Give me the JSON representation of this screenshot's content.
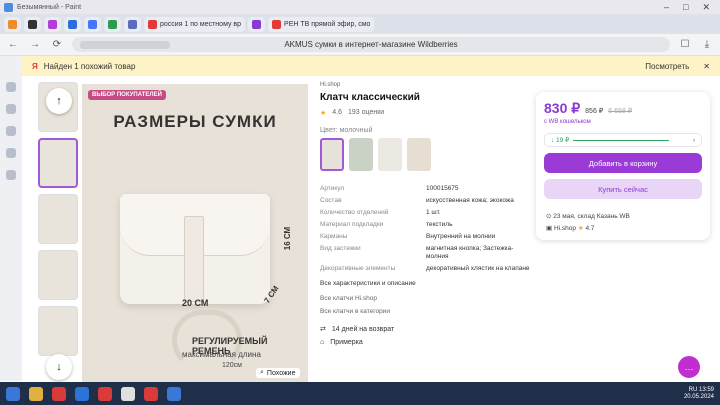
{
  "paint": {
    "title": "Безымянный - Paint"
  },
  "tabs": [
    {
      "label": "",
      "color": "#f08c2b"
    },
    {
      "label": "",
      "color": "#333333"
    },
    {
      "label": "",
      "color": "#b23dd8"
    },
    {
      "label": "",
      "color": "#2a6fdb"
    },
    {
      "label": "",
      "color": "#4477ff"
    },
    {
      "label": "",
      "color": "#2b9b4f"
    },
    {
      "label": "",
      "color": "#5c6bc0"
    },
    {
      "label": "россия 1 по местному вр",
      "color": "#e53935"
    },
    {
      "label": "",
      "color": "#8a3ad4"
    },
    {
      "label": "РЕН ТВ прямой эфир, смо",
      "color": "#e53935"
    }
  ],
  "address": {
    "page_title": "AKMUS сумки в интернет-магазине Wildberries"
  },
  "findbar": {
    "text": "Найден 1 похожий товар",
    "view": "Посмотреть"
  },
  "hero": {
    "badge": "ВЫБОР ПОКУПАТЕЛЕЙ",
    "title": "РАЗМЕРЫ СУМКИ",
    "width": "20 СМ",
    "depth": "7 СМ",
    "height": "16 СМ",
    "strap_title": "РЕГУЛИРУЕМЫЙ РЕМЕНЬ",
    "strap_sub": "максимальная длина",
    "strap_len": "120см",
    "zoom": "Похожие"
  },
  "product": {
    "shop": "Hi.shop",
    "title": "Клатч классический",
    "rating": "4.6",
    "reviews": "193 оценки",
    "color_label": "Цвет: молочный",
    "specs": [
      {
        "k": "Артикул",
        "v": "100015675"
      },
      {
        "k": "Состав",
        "v": "искусственная кожа; экокожа"
      },
      {
        "k": "Количество отделений",
        "v": "1 шт."
      },
      {
        "k": "Материал подкладки",
        "v": "текстиль"
      },
      {
        "k": "Карманы",
        "v": "Внутренний на молнии"
      },
      {
        "k": "Вид застежки",
        "v": "магнитная кнопка; Застежка-молния"
      },
      {
        "k": "Декоративные элементы",
        "v": "декоративный хлястик на клапане"
      }
    ],
    "all_specs": "Все характеристики и описание",
    "all_clutch": "Все клатчи Hi.shop",
    "all_category": "Все клатчи в категории",
    "return": "14 дней на возврат",
    "tryon": "Примерка"
  },
  "card": {
    "price": "830 ₽",
    "old_price": "856 ₽",
    "cross_price": "6 658 ₽",
    "wallet": "с WB кошельком",
    "history": "↓ 19 ₽",
    "cart_btn": "Добавить в корзину",
    "buy_btn": "Купить сейчас",
    "delivery": "23 мая, склад Казань WB",
    "seller": "Hi.shop",
    "seller_rating": "4.7"
  },
  "tray": {
    "time": "13:59",
    "date": "20.05.2024",
    "lang": "RU"
  }
}
